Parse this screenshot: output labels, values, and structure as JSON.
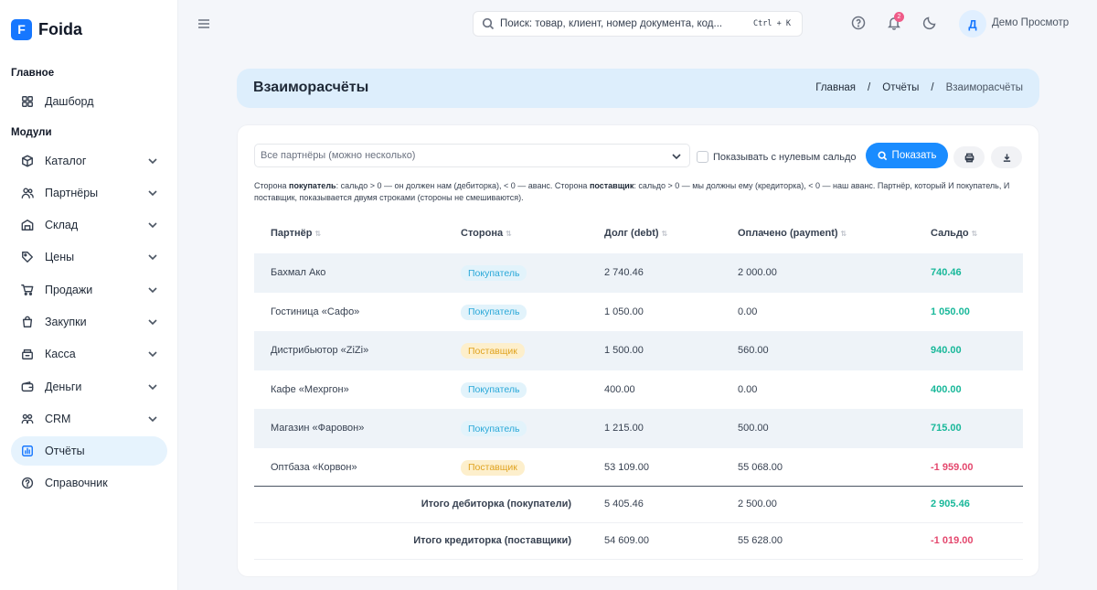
{
  "app": {
    "logo_letter": "F",
    "name": "Foida"
  },
  "sidebar": {
    "main_label": "Главное",
    "modules_label": "Модули",
    "items": [
      {
        "label": "Дашборд",
        "icon": "grid-icon"
      },
      {
        "label": "Каталог",
        "icon": "box-icon"
      },
      {
        "label": "Партнёры",
        "icon": "users-icon"
      },
      {
        "label": "Склад",
        "icon": "warehouse-icon"
      },
      {
        "label": "Цены",
        "icon": "tag-icon"
      },
      {
        "label": "Продажи",
        "icon": "cart-icon"
      },
      {
        "label": "Закупки",
        "icon": "bag-icon"
      },
      {
        "label": "Касса",
        "icon": "cashbox-icon"
      },
      {
        "label": "Деньги",
        "icon": "wallet-icon"
      },
      {
        "label": "CRM",
        "icon": "crm-icon"
      },
      {
        "label": "Отчёты",
        "icon": "chart-icon"
      },
      {
        "label": "Справочник",
        "icon": "help-icon"
      }
    ]
  },
  "header": {
    "search_placeholder": "Поиск: товар, клиент, номер документа, код...",
    "search_shortcut": "Ctrl + K",
    "notification_count": "2",
    "avatar_letter": "Д",
    "user_name": "Демо Просмотр"
  },
  "page": {
    "title": "Взаиморасчёты",
    "breadcrumb": [
      "Главная",
      "Отчёты",
      "Взаиморасчёты"
    ]
  },
  "filters": {
    "partners_placeholder": "Все партнёры (можно несколько)",
    "zero_balance_label": "Показывать с нулевым сальдо",
    "zero_balance_checked": false,
    "show_button": "Показать"
  },
  "note": {
    "p1": "Сторона ",
    "buyer_word": "покупатель",
    "p2": ": сальдо > 0 — он должен нам (дебиторка), < 0 — аванс. Сторона ",
    "supplier_word": "поставщик",
    "p3": ": сальдо > 0 — мы должны ему (кредиторка), < 0 — наш аванс. Партнёр, который И покупатель, И поставщик, показывается двумя строками (стороны не смешиваются)."
  },
  "table": {
    "columns": [
      "Партнёр",
      "Сторона",
      "Долг (debt)",
      "Оплачено (payment)",
      "Сальдо"
    ],
    "rows": [
      {
        "partner": "Бахмал Ако",
        "side": "Покупатель",
        "side_type": "buyer",
        "debt": "2 740.46",
        "payment": "2 000.00",
        "balance": "740.46",
        "negative": false
      },
      {
        "partner": "Гостиница «Сафо»",
        "side": "Покупатель",
        "side_type": "buyer",
        "debt": "1 050.00",
        "payment": "0.00",
        "balance": "1 050.00",
        "negative": false
      },
      {
        "partner": "Дистрибьютор «ZiZi»",
        "side": "Поставщик",
        "side_type": "supplier",
        "debt": "1 500.00",
        "payment": "560.00",
        "balance": "940.00",
        "negative": false
      },
      {
        "partner": "Кафе «Мехргон»",
        "side": "Покупатель",
        "side_type": "buyer",
        "debt": "400.00",
        "payment": "0.00",
        "balance": "400.00",
        "negative": false
      },
      {
        "partner": "Магазин «Фаровон»",
        "side": "Покупатель",
        "side_type": "buyer",
        "debt": "1 215.00",
        "payment": "500.00",
        "balance": "715.00",
        "negative": false
      },
      {
        "partner": "Оптбаза «Корвон»",
        "side": "Поставщик",
        "side_type": "supplier",
        "debt": "53 109.00",
        "payment": "55 068.00",
        "balance": "-1 959.00",
        "negative": true
      }
    ],
    "totals": [
      {
        "label": "Итого дебиторка (покупатели)",
        "debt": "5 405.46",
        "payment": "2 500.00",
        "balance": "2 905.46",
        "negative": false
      },
      {
        "label": "Итого кредиторка (поставщики)",
        "debt": "54 609.00",
        "payment": "55 628.00",
        "balance": "-1 019.00",
        "negative": true
      }
    ]
  }
}
